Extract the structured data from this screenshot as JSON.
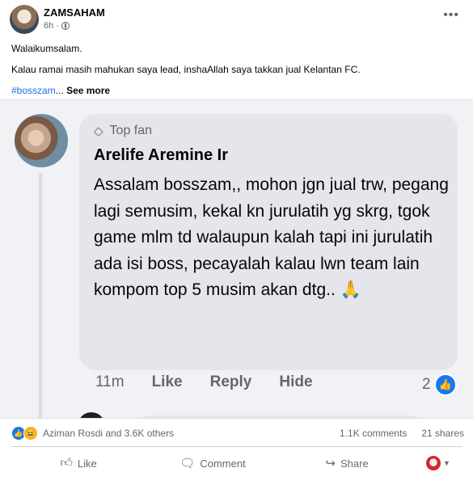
{
  "post": {
    "author": "ZAMSAHAM",
    "time": "6h",
    "more_icon": "ellipsis-icon",
    "text_line1": "Walaikumsalam.",
    "text_line2": "Kalau ramai masih mahukan saya lead, inshaAllah saya takkan jual Kelantan FC.",
    "hashtag": "#bosszam",
    "ellipsis": "...",
    "see_more": "See more"
  },
  "screenshot": {
    "badge_icon": "diamond-icon",
    "badge_label": "Top fan",
    "commenter": "Arelife Aremine Ir",
    "comment_text": "Assalam bosszam,, mohon jgn jual trw, pegang lagi semusim, kekal kn jurulatih yg skrg, tgok game mlm td walaupun kalah tapi ini jurulatih ada isi boss, pecayalah kalau lwn team lain kompom top 5 musim akan dtg..",
    "emoji": "🙏",
    "time": "11m",
    "like": "Like",
    "reply": "Reply",
    "hide": "Hide",
    "reaction_count": "2"
  },
  "stats": {
    "reactions_text": "Aziman Rosdi and 3.6K others",
    "comments": "1.1K comments",
    "shares": "21 shares"
  },
  "actions": {
    "like": "Like",
    "comment": "Comment",
    "share": "Share"
  },
  "colors": {
    "accent": "#1877f2",
    "hashtag": "#216fdb",
    "muted": "#65676b"
  }
}
